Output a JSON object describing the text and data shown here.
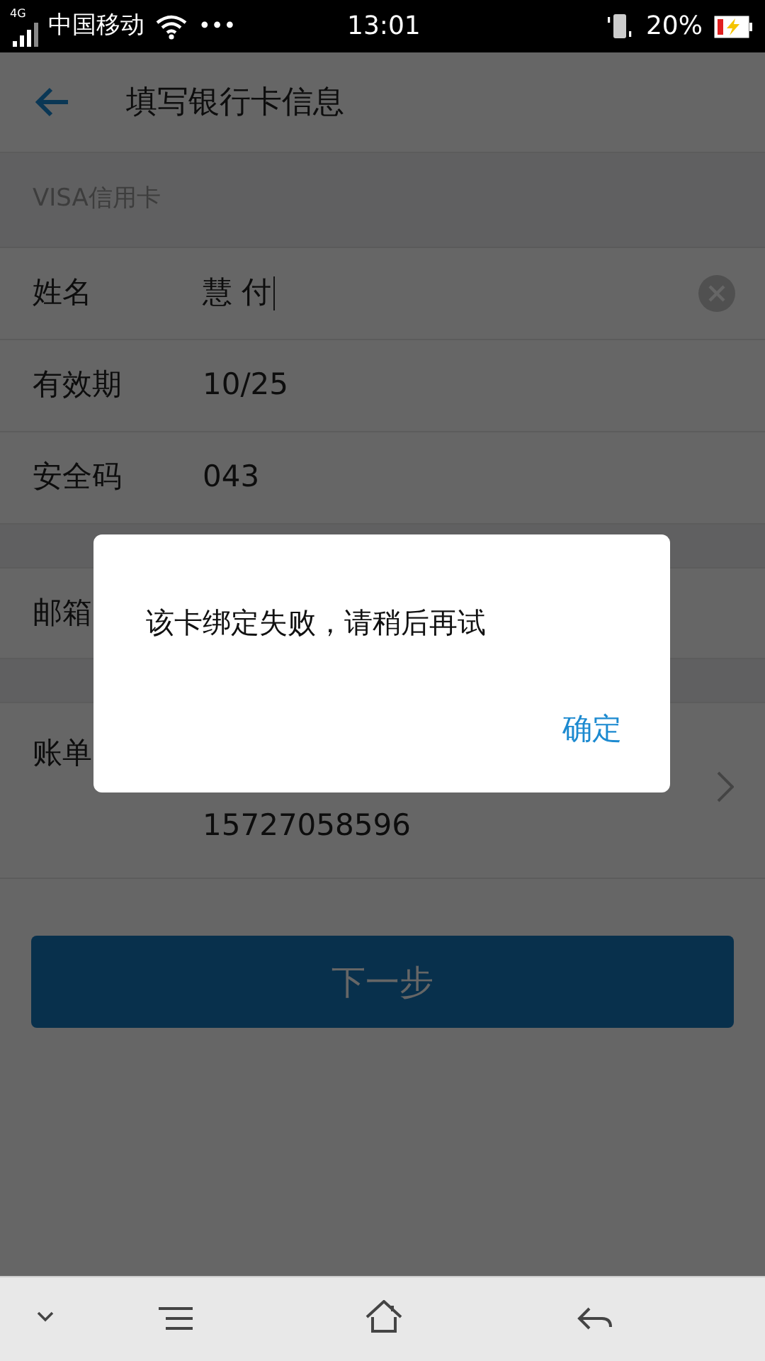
{
  "status_bar": {
    "network": "4G",
    "carrier": "中国移动",
    "more": "•••",
    "time": "13:01",
    "battery": "20%",
    "charging": true
  },
  "header": {
    "title": "填写银行卡信息"
  },
  "section": {
    "title": "VISA信用卡"
  },
  "fields": [
    {
      "label": "姓名",
      "value": "慧 付",
      "focused": true
    },
    {
      "label": "有效期",
      "value": "10/25",
      "focused": false
    },
    {
      "label": "安全码",
      "value": "043",
      "focused": false
    }
  ],
  "email_row": {
    "label": "邮箱"
  },
  "bill_row": {
    "label": "账单",
    "value": "15727058596"
  },
  "next_button": {
    "label": "下一步"
  },
  "dialog": {
    "message": "该卡绑定失败，请稍后再试",
    "confirm": "确定"
  }
}
